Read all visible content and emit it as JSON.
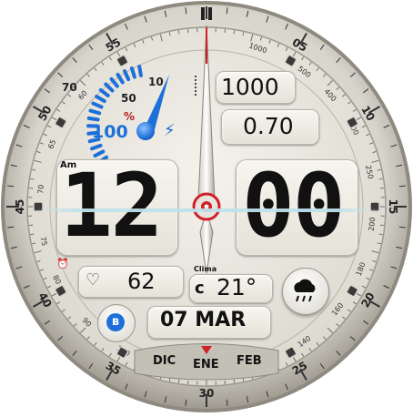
{
  "watch": {
    "outer_ring_labels": [
      "55",
      "05",
      "10",
      "15",
      "20",
      "25",
      "30",
      "35",
      "40",
      "45",
      "50"
    ],
    "tachymeter_labels": [
      "1000",
      "500",
      "400",
      "300",
      "250",
      "200",
      "180",
      "160",
      "140",
      "120",
      "100",
      "90",
      "80",
      "75",
      "70",
      "65",
      "60"
    ],
    "battery": {
      "scale_labels": [
        "70",
        "50",
        "10"
      ],
      "unit": "%",
      "value": "100",
      "fraction": 1.0
    },
    "steps": "1000",
    "distance": "0.70",
    "time": {
      "ampm": "Am",
      "hours": "12",
      "minutes": "00"
    },
    "heart_rate": "62",
    "weather": {
      "label": "Clima",
      "unit": "c",
      "temp": "21°",
      "icon": "rain-cloud-icon"
    },
    "date": "07 MAR",
    "months": [
      "DIC",
      "ENE",
      "FEB"
    ],
    "colors": {
      "accent": "#1e6fd9",
      "hand_red": "#d0202a",
      "face": "#e9e7de",
      "bezel": "#c9c6bc"
    }
  }
}
